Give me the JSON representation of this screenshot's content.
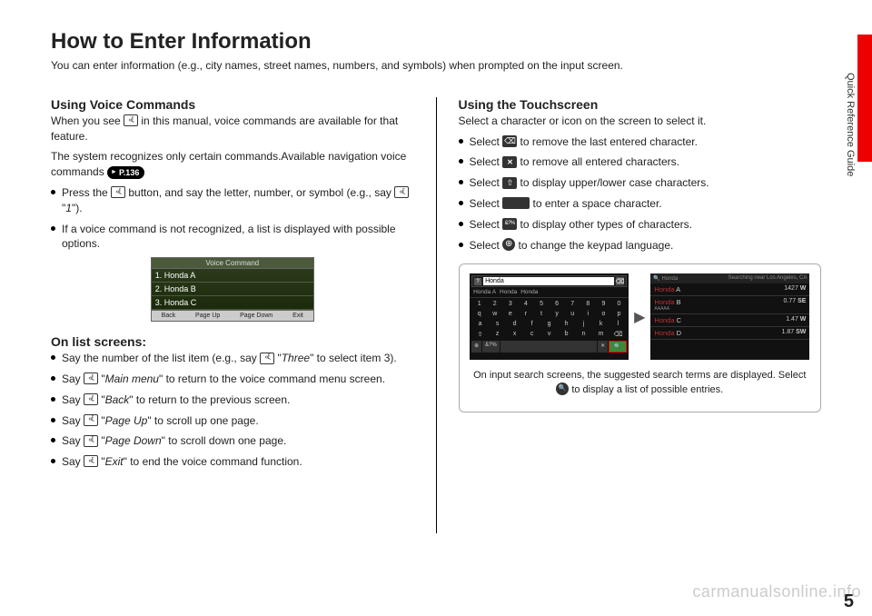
{
  "page": {
    "title": "How to Enter Information",
    "subtitle": "You can enter information (e.g., city names, street names, numbers, and symbols) when prompted on the input screen.",
    "side_label": "Quick Reference Guide",
    "page_number": "5",
    "watermark": "carmanualsonline.info"
  },
  "left": {
    "h_voice": "Using Voice Commands",
    "voice_intro_a": "When you see ",
    "voice_intro_b": " in this manual, voice commands are available for that feature.",
    "voice_recog": "The system recognizes only certain commands.Available navigation voice commands ",
    "pill": "P.136",
    "bul1_a": "Press the ",
    "bul1_b": " button, and say the letter, number, or symbol (e.g., say ",
    "bul1_cmd": "1",
    "bul1_c": ").",
    "bul2": "If a voice command is not recognized, a list is displayed with possible options.",
    "vc": {
      "title": "Voice Command",
      "items": [
        "1. Honda A",
        "2. Honda B",
        "3. Honda C"
      ],
      "footer": [
        "Back",
        "Page Up",
        "Page Down",
        "Exit"
      ]
    },
    "h_list": "On list screens:",
    "list_items": [
      {
        "a": "Say the number of the list item (e.g., say ",
        "cmd": "Three",
        "b": " to select item 3)."
      },
      {
        "a": "Say ",
        "cmd": "Main menu",
        "b": " to return to the voice command menu screen."
      },
      {
        "a": "Say ",
        "cmd": "Back",
        "b": " to return to the previous screen."
      },
      {
        "a": "Say ",
        "cmd": "Page Up",
        "b": " to scroll up one page."
      },
      {
        "a": "Say ",
        "cmd": "Page Down",
        "b": " to scroll down one page."
      },
      {
        "a": "Say ",
        "cmd": "Exit",
        "b": " to end the voice command function."
      }
    ]
  },
  "right": {
    "h_touch": "Using the Touchscreen",
    "touch_intro": "Select a character or icon on the screen to select it.",
    "items": [
      {
        "a": "Select ",
        "icon": "back",
        "b": " to remove the last entered character."
      },
      {
        "a": "Select ",
        "icon": "x",
        "b": " to remove all entered characters."
      },
      {
        "a": "Select ",
        "icon": "shift",
        "b": " to display upper/lower case characters."
      },
      {
        "a": "Select ",
        "icon": "space",
        "b": " to enter a space character."
      },
      {
        "a": "Select ",
        "icon": "sym",
        "b": " to display other types of characters."
      },
      {
        "a": "Select ",
        "icon": "globe",
        "b": " to change the keypad language."
      }
    ],
    "screens": {
      "input_value": "Honda",
      "suggestions": [
        "Honda A",
        "Honda",
        "Honda"
      ],
      "kb_r1": [
        "1",
        "2",
        "3",
        "4",
        "5",
        "6",
        "7",
        "8",
        "9",
        "0"
      ],
      "kb_r2": [
        "q",
        "w",
        "e",
        "r",
        "t",
        "y",
        "u",
        "i",
        "o",
        "p"
      ],
      "kb_r3": [
        "a",
        "s",
        "d",
        "f",
        "g",
        "h",
        "j",
        "k",
        "l"
      ],
      "kb_r4": [
        "⇧",
        "z",
        "x",
        "c",
        "v",
        "b",
        "n",
        "m",
        "⌫"
      ],
      "kb_bottom": {
        "sym": "&?%",
        "space": "",
        "x": "✕",
        "search": "🔍"
      },
      "right_header_a": "Honda",
      "right_header_b": "Searching near Los Angeles, CA",
      "results": [
        {
          "name": "Honda",
          "suf": " A",
          "dist": "1427",
          "dir": "W"
        },
        {
          "name": "Honda",
          "suf": " B",
          "sub": "AAAAA",
          "dist": "0.77",
          "dir": "SE"
        },
        {
          "name": "Honda",
          "suf": " C",
          "dist": "1.47",
          "dir": "W"
        },
        {
          "name": "Honda",
          "suf": " D",
          "dist": "1.87",
          "dir": "SW"
        }
      ]
    },
    "caption_a": "On input search screens, the suggested search terms are displayed. Select ",
    "caption_b": " to display a list of possible entries."
  }
}
